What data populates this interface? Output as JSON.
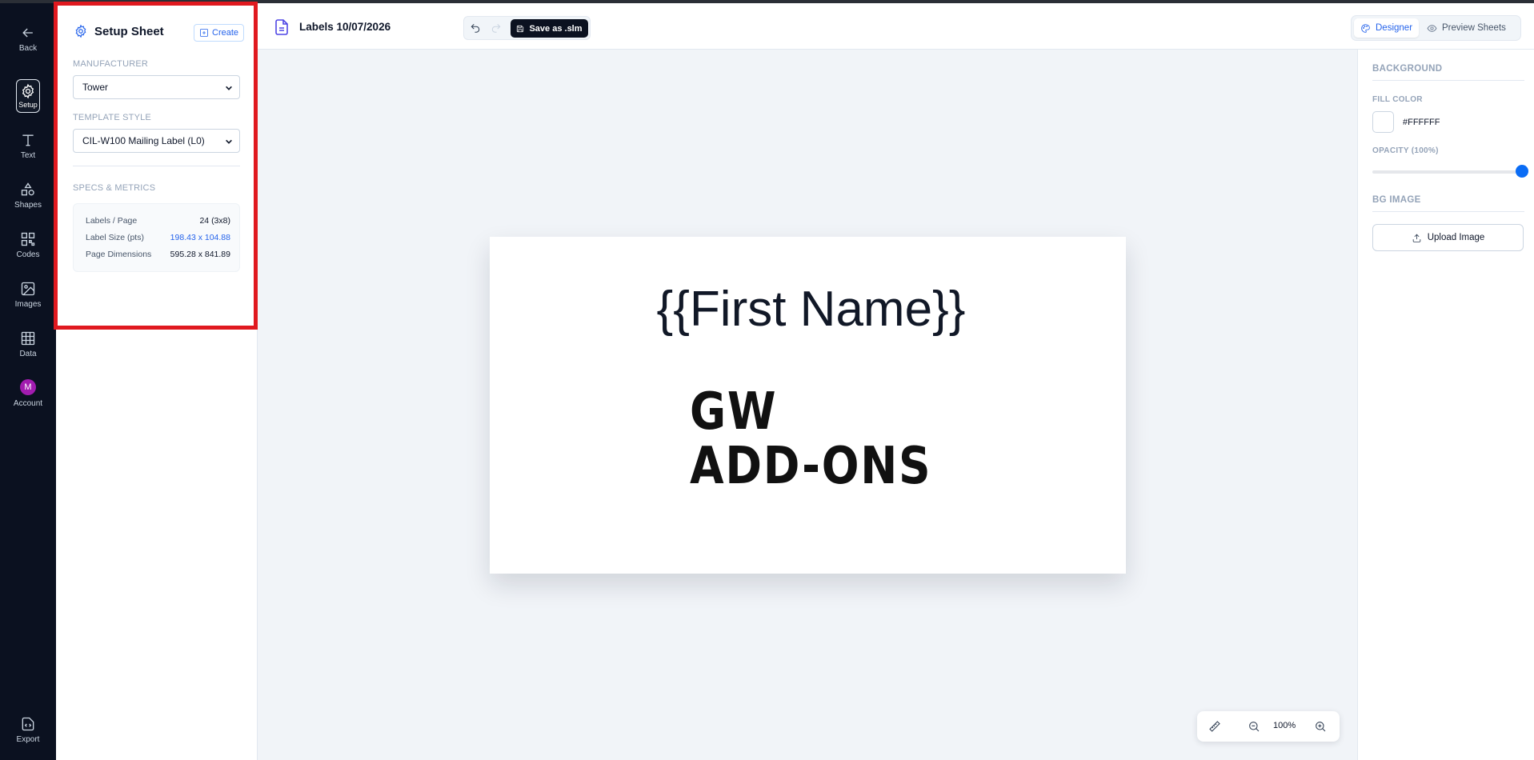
{
  "rail": {
    "back": "Back",
    "setup": "Setup",
    "text": "Text",
    "shapes": "Shapes",
    "codes": "Codes",
    "images": "Images",
    "data": "Data",
    "account": "Account",
    "account_initial": "M",
    "export": "Export"
  },
  "setup": {
    "title": "Setup Sheet",
    "create_label": "Create",
    "manufacturer_label": "MANUFACTURER",
    "manufacturer_value": "Tower",
    "template_label": "TEMPLATE STYLE",
    "template_value": "CIL-W100 Mailing Label (L0)",
    "specs_label": "SPECS & METRICS",
    "specs": [
      {
        "key": "Labels / Page",
        "value": "24 (3x8)"
      },
      {
        "key": "Label Size (pts)",
        "value": "198.43 x 104.88"
      },
      {
        "key": "Page Dimensions",
        "value": "595.28 x 841.89"
      }
    ]
  },
  "topbar": {
    "doc_title": "Labels 10/07/2026",
    "save_label": "Save as .slm",
    "designer_label": "Designer",
    "preview_label": "Preview Sheets"
  },
  "canvas": {
    "field_text": "{{First Name}}",
    "logo_line1": "GW",
    "logo_line2": "ADD-ONS"
  },
  "props": {
    "background_heading": "BACKGROUND",
    "fill_color_label": "FILL COLOR",
    "fill_color_value": "#FFFFFF",
    "opacity_label": "OPACITY (100%)",
    "opacity_value": 1.0,
    "bg_image_heading": "BG IMAGE",
    "upload_label": "Upload Image"
  },
  "zoom": {
    "level": "100%"
  },
  "colors": {
    "accent": "#2563eb",
    "rail_bg": "#0b1120",
    "highlight_border": "#e0191f",
    "slider_thumb": "#0a6cf5",
    "avatar": "#a21caf"
  }
}
